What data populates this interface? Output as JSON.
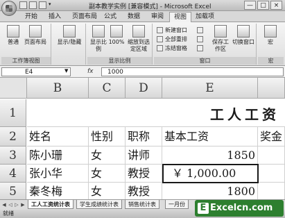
{
  "window": {
    "title": "副本教学实例 [兼容模式] - Microsoft Excel",
    "controls": [
      "—",
      "□",
      "×"
    ]
  },
  "tabs": [
    "开始",
    "插入",
    "页面布局",
    "公式",
    "数据",
    "审阅",
    "视图",
    "加载项"
  ],
  "active_tab": "视图",
  "ribbon": {
    "workbook_views": {
      "label": "工作簿视图",
      "normal": "普通",
      "page_layout": "页面布局"
    },
    "show_hide": {
      "label": "显示/隐藏"
    },
    "zoom": {
      "label": "显示比例",
      "zoom": "显示比例",
      "zoom_100": "100%",
      "zoom_selection": "缩放到选定区域"
    },
    "window": {
      "label": "窗口",
      "new_window": "新建窗口",
      "arrange_all": "全部重排",
      "freeze_panes": "冻结窗格",
      "save_workspace": "保存工作区",
      "switch_windows": "切换窗口"
    },
    "macros": {
      "label": "宏",
      "macros": "宏"
    }
  },
  "formula_bar": {
    "name_box": "E4",
    "fx": "fx",
    "value": "1000"
  },
  "columns": [
    "B",
    "C",
    "D",
    "E"
  ],
  "rows": [
    "1",
    "2",
    "3",
    "4",
    "5"
  ],
  "sheet_title": "工人工资",
  "header_row": [
    "姓名",
    "性别",
    "职称",
    "基本工资",
    "奖金"
  ],
  "data_rows": [
    [
      "陈小珊",
      "女",
      "讲师",
      "1850"
    ],
    [
      "张小华",
      "女",
      "教授",
      "￥ 1,000.00"
    ],
    [
      "秦冬梅",
      "女",
      "教授",
      "1800"
    ]
  ],
  "sheet_tabs": [
    "工人工资统计表",
    "学生成绩统计表",
    "销售统计表",
    "一月份"
  ],
  "status": "就绪",
  "watermark": "Excelcn.com"
}
